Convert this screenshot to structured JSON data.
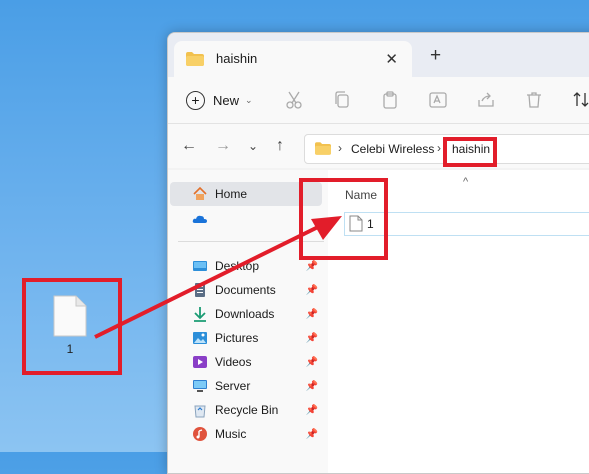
{
  "desktop": {
    "file_label": "1"
  },
  "window": {
    "tab_title": "haishin",
    "new_label": "New",
    "breadcrumb": [
      "Celebi Wireless",
      "haishin"
    ],
    "sidebar": [
      {
        "label": "Home",
        "icon": "home-icon"
      },
      {
        "label": "",
        "icon": "onedrive-icon"
      },
      {
        "label": "Desktop",
        "icon": "desktop-icon"
      },
      {
        "label": "Documents",
        "icon": "documents-icon"
      },
      {
        "label": "Downloads",
        "icon": "downloads-icon"
      },
      {
        "label": "Pictures",
        "icon": "pictures-icon"
      },
      {
        "label": "Videos",
        "icon": "videos-icon"
      },
      {
        "label": "Server",
        "icon": "server-icon"
      },
      {
        "label": "Recycle Bin",
        "icon": "recycle-bin-icon"
      },
      {
        "label": "Music",
        "icon": "music-icon"
      }
    ],
    "column_header": "Name",
    "files": [
      {
        "name": "1"
      }
    ]
  },
  "annotation_color": "#e21d2a"
}
